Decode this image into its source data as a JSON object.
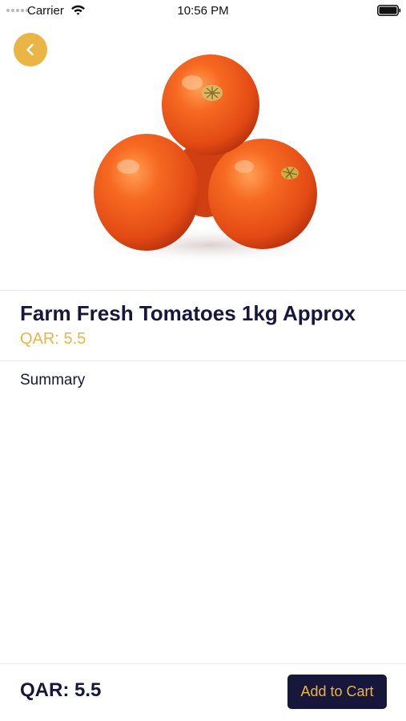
{
  "status_bar": {
    "carrier": "Carrier",
    "time": "10:56 PM",
    "wifi_icon": "wifi-icon",
    "battery_icon": "battery-icon"
  },
  "header": {
    "back_icon": "chevron-left-icon"
  },
  "product": {
    "image_alt": "tomatoes",
    "title": "Farm Fresh Tomatoes 1kg Approx",
    "price": "QAR: 5.5",
    "summary_label": "Summary"
  },
  "footer": {
    "price": "QAR: 5.5",
    "add_to_cart_label": "Add to Cart"
  },
  "colors": {
    "accent": "#e9b545",
    "navy": "#16173b",
    "divider": "#ececec"
  }
}
